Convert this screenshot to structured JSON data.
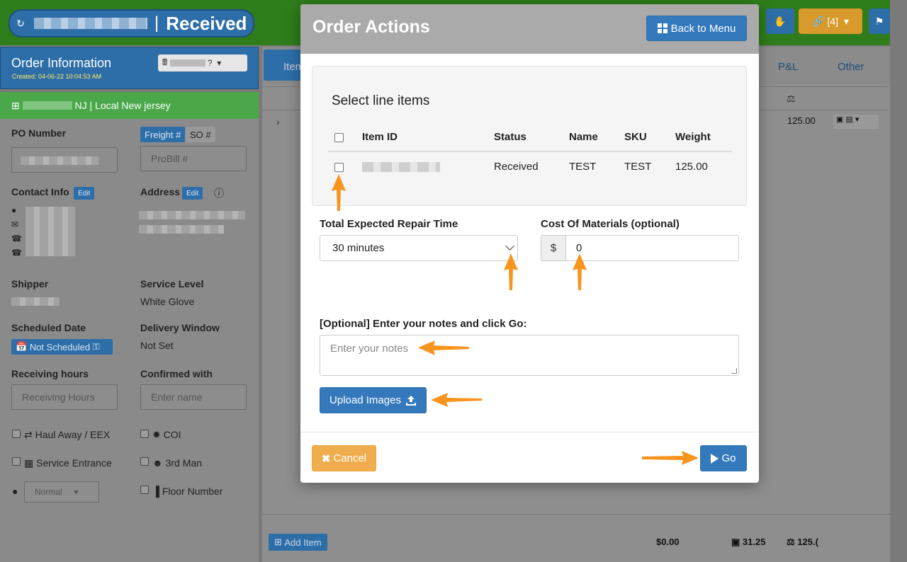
{
  "topbar": {
    "status": "Received",
    "separator": "|",
    "link_badge": "[4]",
    "refresh_icon": "refresh-icon",
    "hand_icon": "hand-icon",
    "flag_icon": "flag-icon"
  },
  "left_panel": {
    "title": "Order Information",
    "created": "Created: 04-06-22 10:04:53 AM",
    "location": "NJ | Local New jersey",
    "po_label": "PO Number",
    "freight_tab": "Freight #",
    "so_tab": "SO #",
    "probill_placeholder": "ProBill #",
    "contact_label": "Contact Info",
    "address_label": "Address",
    "edit_label": "Edit",
    "shipper_label": "Shipper",
    "service_level_label": "Service Level",
    "service_level_value": "White Glove",
    "scheduled_label": "Scheduled Date",
    "scheduled_value": "Not Scheduled",
    "delivery_window_label": "Delivery Window",
    "delivery_window_value": "Not Set",
    "receiving_label": "Receiving hours",
    "receiving_placeholder": "Receiving Hours",
    "confirmed_label": "Confirmed with",
    "confirmed_placeholder": "Enter name",
    "haul_away": "Haul Away / EEX",
    "coi": "COI",
    "service_entrance": "Service Entrance",
    "third_man": "3rd Man",
    "priority": "Normal",
    "floor_number": "Floor Number"
  },
  "right_panel": {
    "tab_items": "Item",
    "tab_pl": "P&L",
    "tab_other": "Other",
    "row_weight": "125.00",
    "add_item": "Add Item",
    "total_cost": "$0.00",
    "total_cubes": "31.25",
    "total_weight": "125.("
  },
  "modal": {
    "title": "Order Actions",
    "back_button": "Back to Menu",
    "select_title": "Select line items",
    "columns": [
      "Item ID",
      "Status",
      "Name",
      "SKU",
      "Weight"
    ],
    "rows": [
      {
        "status": "Received",
        "name": "TEST",
        "sku": "TEST",
        "weight": "125.00"
      }
    ],
    "repair_label": "Total Expected Repair Time",
    "repair_value": "30 minutes",
    "cost_label": "Cost Of Materials (optional)",
    "cost_prefix": "$",
    "cost_value": "0",
    "notes_label": "[Optional] Enter your notes and click Go:",
    "notes_placeholder": "Enter your notes",
    "upload_button": "Upload Images",
    "cancel_button": "Cancel",
    "go_button": "Go"
  },
  "colors": {
    "primary": "#3579bd",
    "warning": "#f0ad4e",
    "header_gray": "#aaaaaa",
    "annotation_arrow": "#f7941d",
    "topbar_green": "#2e7d1a"
  }
}
